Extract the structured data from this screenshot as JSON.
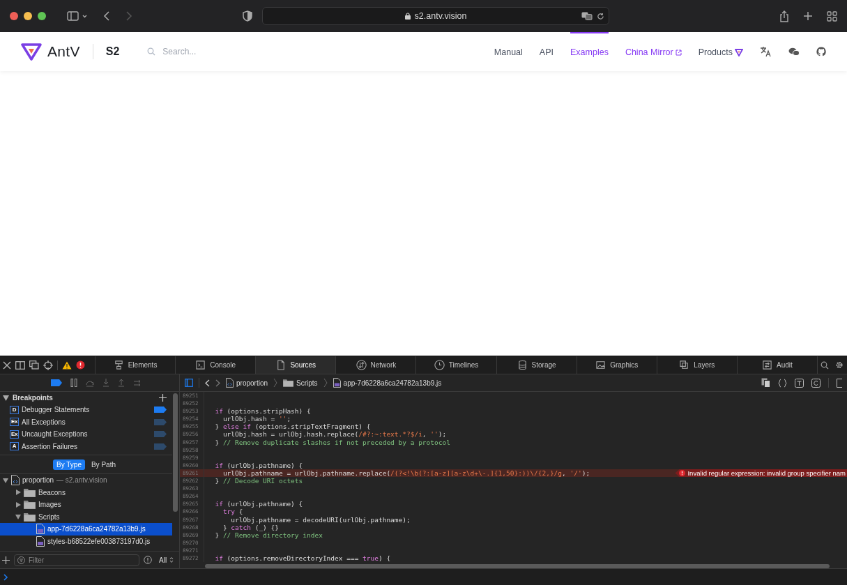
{
  "browser": {
    "url": "s2.antv.vision"
  },
  "site": {
    "logo": "AntV",
    "product": "S2",
    "search_placeholder": "Search...",
    "nav": [
      {
        "label": "Manual",
        "kind": "link",
        "selected": false
      },
      {
        "label": "API",
        "kind": "link",
        "selected": false
      },
      {
        "label": "Examples",
        "kind": "link",
        "selected": true
      },
      {
        "label": "China Mirror",
        "kind": "external",
        "selected": false
      },
      {
        "label": "Products",
        "kind": "menu",
        "selected": false
      }
    ]
  },
  "devtools": {
    "tabs": [
      {
        "label": "Elements",
        "selected": false
      },
      {
        "label": "Console",
        "selected": false
      },
      {
        "label": "Sources",
        "selected": true
      },
      {
        "label": "Network",
        "selected": false
      },
      {
        "label": "Timelines",
        "selected": false
      },
      {
        "label": "Storage",
        "selected": false
      },
      {
        "label": "Graphics",
        "selected": false
      },
      {
        "label": "Layers",
        "selected": false
      },
      {
        "label": "Audit",
        "selected": false
      }
    ],
    "breadcrumb": [
      "proportion",
      "Scripts",
      "app-7d6228a6ca24782a13b9.js"
    ],
    "breakpoints": {
      "title": "Breakpoints",
      "items": [
        {
          "badge": "D",
          "label": "Debugger Statements",
          "enabled": true
        },
        {
          "badge": "Ex",
          "label": "All Exceptions",
          "enabled": false
        },
        {
          "badge": "Ex",
          "label": "Uncaught Exceptions",
          "enabled": false
        },
        {
          "badge": "A",
          "label": "Assertion Failures",
          "enabled": false
        }
      ]
    },
    "grouping": [
      {
        "label": "By Type",
        "selected": true
      },
      {
        "label": "By Path",
        "selected": false
      }
    ],
    "tree": [
      {
        "label": "proportion",
        "detail": "— s2.antv.vision",
        "kind": "origin",
        "expanded": true,
        "selected": false,
        "children": [
          {
            "label": "Beacons",
            "kind": "folder",
            "expanded": false,
            "selected": false
          },
          {
            "label": "Images",
            "kind": "folder",
            "expanded": false,
            "selected": false
          },
          {
            "label": "Scripts",
            "kind": "folder",
            "expanded": true,
            "selected": false,
            "children": [
              {
                "label": "app-7d6228a6ca24782a13b9.js",
                "kind": "file",
                "selected": true
              },
              {
                "label": "styles-b68522efe003873197d0.js",
                "kind": "file",
                "selected": false
              }
            ]
          }
        ]
      }
    ],
    "filter": {
      "placeholder": "Filter",
      "scope": "All"
    },
    "code": [
      {
        "number": "89251"
      },
      {
        "number": "89252"
      },
      {
        "number": "89253",
        "segments": [
          {
            "kind": "keyword",
            "text": "  if"
          },
          {
            "kind": "plain",
            "text": " (options.stripHash) {"
          }
        ]
      },
      {
        "number": "89254",
        "segments": [
          {
            "kind": "plain",
            "text": "    urlObj.hash = "
          },
          {
            "kind": "string",
            "text": "''"
          },
          {
            "kind": "plain",
            "text": ";"
          }
        ]
      },
      {
        "number": "89255",
        "segments": [
          {
            "kind": "plain",
            "text": "  } "
          },
          {
            "kind": "keyword",
            "text": "else if"
          },
          {
            "kind": "plain",
            "text": " (options.stripTextFragment) {"
          }
        ]
      },
      {
        "number": "89256",
        "segments": [
          {
            "kind": "plain",
            "text": "    urlObj.hash = urlObj.hash.replace("
          },
          {
            "kind": "string",
            "text": "/#?:~:text.*?$/i"
          },
          {
            "kind": "plain",
            "text": ", "
          },
          {
            "kind": "string",
            "text": "''"
          },
          {
            "kind": "plain",
            "text": ");"
          }
        ]
      },
      {
        "number": "89257",
        "segments": [
          {
            "kind": "plain",
            "text": "  } "
          },
          {
            "kind": "comment",
            "text": "// Remove duplicate slashes if not preceded by a protocol"
          }
        ]
      },
      {
        "number": "89258"
      },
      {
        "number": "89259"
      },
      {
        "number": "89260",
        "segments": [
          {
            "kind": "keyword",
            "text": "  if"
          },
          {
            "kind": "plain",
            "text": " (urlObj.pathname) {"
          }
        ]
      },
      {
        "number": "89261",
        "error": "Invalid regular expression: invalid group specifier nam",
        "segments": [
          {
            "kind": "plain",
            "text": "    urlObj.pathname = urlObj.pathname.replace("
          },
          {
            "kind": "string",
            "text": "/(?<!\\b(?:[a-z][a-z\\d+\\-.]{1,50}:))\\/{2,}/g"
          },
          {
            "kind": "plain",
            "text": ", "
          },
          {
            "kind": "string",
            "text": "'/'"
          },
          {
            "kind": "plain",
            "text": ");"
          }
        ]
      },
      {
        "number": "89262",
        "segments": [
          {
            "kind": "plain",
            "text": "  } "
          },
          {
            "kind": "comment",
            "text": "// Decode URI octets"
          }
        ]
      },
      {
        "number": "89263"
      },
      {
        "number": "89264"
      },
      {
        "number": "89265",
        "segments": [
          {
            "kind": "keyword",
            "text": "  if"
          },
          {
            "kind": "plain",
            "text": " (urlObj.pathname) {"
          }
        ]
      },
      {
        "number": "89266",
        "segments": [
          {
            "kind": "keyword",
            "text": "    try"
          },
          {
            "kind": "plain",
            "text": " {"
          }
        ]
      },
      {
        "number": "89267",
        "segments": [
          {
            "kind": "plain",
            "text": "      urlObj.pathname = decodeURI(urlObj.pathname);"
          }
        ]
      },
      {
        "number": "89268",
        "segments": [
          {
            "kind": "plain",
            "text": "    } "
          },
          {
            "kind": "keyword",
            "text": "catch"
          },
          {
            "kind": "plain",
            "text": " (_) {}"
          }
        ]
      },
      {
        "number": "89269",
        "segments": [
          {
            "kind": "plain",
            "text": "  } "
          },
          {
            "kind": "comment",
            "text": "// Remove directory index"
          }
        ]
      },
      {
        "number": "89270"
      },
      {
        "number": "89271"
      },
      {
        "number": "89272",
        "segments": [
          {
            "kind": "keyword",
            "text": "  if"
          },
          {
            "kind": "plain",
            "text": " (options.removeDirectoryIndex === "
          },
          {
            "kind": "keyword",
            "text": "true"
          },
          {
            "kind": "plain",
            "text": ") {"
          }
        ]
      }
    ]
  }
}
